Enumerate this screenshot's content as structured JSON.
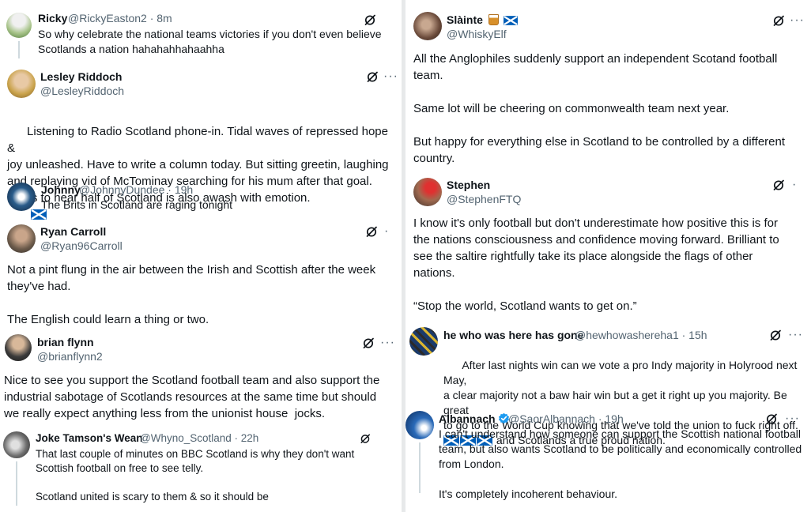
{
  "left": {
    "ricky": {
      "name": "Ricky",
      "handle": "@RickyEaston2 · 8m",
      "body": "So why celebrate the national teams victories if you don't even believe\nScotlands a nation hahahahhahaahha"
    },
    "lesley": {
      "name": "Lesley Riddoch",
      "handle": "@LesleyRiddoch",
      "body": "Listening to Radio Scotland phone-in. Tidal waves of repressed hope &\njoy unleashed. Have to write a column today. But sitting greetin, laughing\nand replaying vid of McTominay searching for his mum after that goal.\nHelps to hear half of Scotland is also awash with emotion."
    },
    "johnny": {
      "name": "Johnny",
      "handle": "@JohnnyDundee · 19h",
      "body": "The Brits in Scotland are raging tonight"
    },
    "ryan": {
      "name": "Ryan Carroll",
      "handle": "@Ryan96Carroll",
      "body": "Not a pint flung in the air between the Irish and Scottish after the week\nthey've had.\n\nThe English could learn a thing or two."
    },
    "brian": {
      "name": "brian flynn",
      "handle": "@brianflynn2",
      "body": "Nice to see you support the Scotland football team and also support the\nindustrial sabotage of Scotlands resources at the same time but should\nwe really expect anything less from the unionist house  jocks."
    },
    "joke": {
      "name": "Joke Tamson's Wean",
      "handle": "@Whyno_Scotland · 22h",
      "body": "That last couple of minutes on BBC Scotland is why they don't want\nScottish football on free to see telly.\n\nScotland united is scary to them & so it should be"
    }
  },
  "right": {
    "slainte": {
      "name": "Slàinte",
      "handle": "@WhiskyElf",
      "body": "All the Anglophiles suddenly support an independent Scotand football\nteam.\n\nSame lot will be cheering on commonwealth team next year.\n\nBut happy for everything else in Scotland to be controlled by a different\ncountry."
    },
    "stephen": {
      "name": "Stephen",
      "handle": "@StephenFTQ",
      "body": "I know it's only football but don't underestimate how positive this is for\nthe nations consciousness and confidence moving forward. Brilliant to\nsee the saltire rightfully take its place alongside the flags of other\nnations.\n\n“Stop the world, Scotland wants to get on.”"
    },
    "hewho": {
      "name": "he who was here has gone",
      "handle": "@hewhowashereha1 · 15h",
      "body": "After last nights win can we vote a pro Indy majority in Holyrood next May,\na clear majority not a baw hair win but a get it right up you majority. Be great\nto go to the World Cup knowing that we've told the union to fuck right off.",
      "body_tail": " and Scotlands a true proud nation."
    },
    "albannach": {
      "name": "Albannach",
      "handle": "@SaorAlbannach · 19h",
      "body": "I can't understand how someone can support the Scottish national football\nteam, but also wants Scotland to be politically and economically controlled\nfrom London.\n\nIt's completely incoherent behaviour."
    }
  },
  "icons": {
    "grok": "grok-icon",
    "more": "more-icon",
    "flag": "scotland-flag-icon",
    "verified": "verified-badge-icon"
  },
  "more_glyph": "···",
  "colors": {
    "text": "#0f1419",
    "secondary": "#536471",
    "saltire": "#005eb8",
    "verified": "#1d9bf0"
  }
}
